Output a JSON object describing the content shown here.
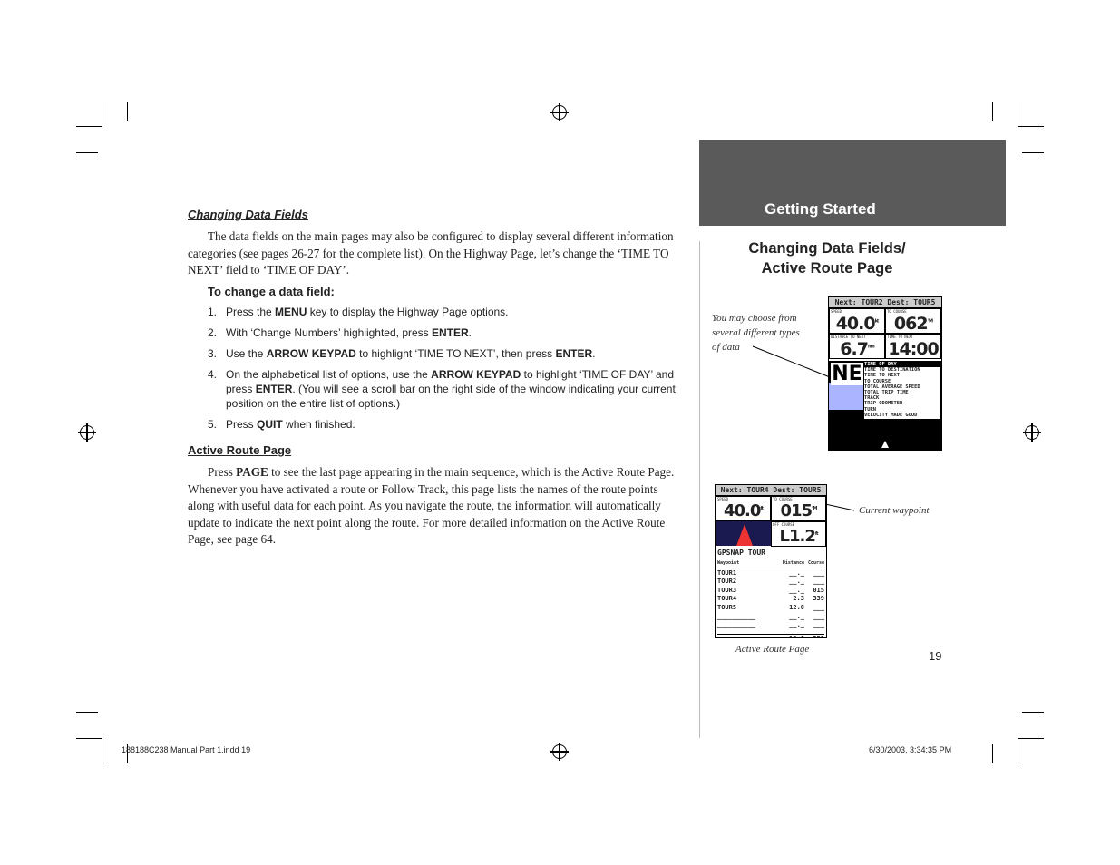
{
  "left": {
    "heading1": "Changing Data Fields",
    "para1": "The data fields on the main pages may also be configured to display several different information categories (see pages 26-27 for the complete list). On the Highway Page, let’s change the ‘TIME TO NEXT’ field to ‘TIME OF DAY’.",
    "subhead": "To change a data field:",
    "steps": [
      {
        "num": "1.",
        "parts": [
          "Press the ",
          "MENU",
          " key to display the Highway Page options."
        ]
      },
      {
        "num": "2.",
        "parts": [
          "With ‘Change Numbers’ highlighted, press ",
          "ENTER",
          "."
        ]
      },
      {
        "num": "3.",
        "parts": [
          "Use the ",
          "ARROW KEYPAD",
          " to highlight ‘TIME TO NEXT’, then press ",
          "ENTER",
          "."
        ]
      },
      {
        "num": "4.",
        "parts": [
          "On the alphabetical list of options, use the ",
          "ARROW KEYPAD",
          " to highlight ‘TIME OF DAY’ and press ",
          "ENTER",
          ". (You will see a scroll bar on the right side of the window indicating your current position on the entire list of options.)"
        ]
      },
      {
        "num": "5.",
        "parts": [
          "Press ",
          "QUIT",
          " when finished."
        ]
      }
    ],
    "heading2": "Active Route Page",
    "para2_pre": "Press ",
    "para2_key": "PAGE",
    "para2_post": " to see the last page appearing in the main sequence, which is the Active Route Page. Whenever you have activated a route or Follow Track, this page lists the names of the route points along with useful data for each point. As you navigate the route, the information will automatically update to indicate the next point along the route. For more detailed information on the Active Route Page, see page 64."
  },
  "right": {
    "tab_label": "Getting Started",
    "tab_color": "#5a5a5a",
    "title_line1": "Changing Data Fields/",
    "title_line2": "Active Route Page",
    "caption1": "You may choose from several different types of data",
    "caption2": "Current waypoint",
    "caption3": "Active Route Page",
    "page_number": "19"
  },
  "screen1": {
    "header": "Next: TOUR2   Dest: TOUR5",
    "fields": [
      {
        "label": "SPEED",
        "value": "40.0",
        "unit": "kt"
      },
      {
        "label": "TO COURSE",
        "value": "062",
        "unit": "°M"
      },
      {
        "label": "DISTANCE TO NEXT",
        "value": "6.7",
        "unit": "nm"
      },
      {
        "label": "TIME TO NEXT",
        "value": "14:00",
        "unit": ""
      }
    ],
    "compass": "NE",
    "options": [
      "TIME OF DAY",
      "TIME TO DESTINATION",
      "TIME TO NEXT",
      "TO COURSE",
      "TOTAL AVERAGE SPEED",
      "TOTAL TRIP TIME",
      "TRACK",
      "TRIP ODOMETER",
      "TURN",
      "VELOCITY MADE GOOD"
    ],
    "selected": "TIME OF DAY"
  },
  "screen2": {
    "header": "Next: TOUR4   Dest: TOUR5",
    "fields": [
      {
        "label": "SPEED",
        "value": "40.0",
        "unit": "ft"
      },
      {
        "label": "TO COURSE",
        "value": "015",
        "unit": "°M"
      },
      {
        "label": "OFF COURSE",
        "value": "L1.2",
        "unit": "ft"
      }
    ],
    "route_name": "GPSNAP TOUR",
    "columns": [
      "Waypoint",
      "Distance",
      "Course"
    ],
    "rows": [
      [
        "TOUR1",
        "__._",
        "___"
      ],
      [
        "TOUR2",
        "__._",
        "___"
      ],
      [
        "TOUR3",
        "__._",
        "015"
      ],
      [
        "TOUR4",
        "2.3",
        "339"
      ],
      [
        "TOUR5",
        "12.0",
        "___"
      ],
      [
        "__________",
        "__._",
        "___"
      ],
      [
        "__________",
        "__._",
        "___"
      ]
    ],
    "total": [
      "",
      "12.0",
      "351"
    ]
  },
  "footer": {
    "file": "188188C238 Manual Part 1.indd   19",
    "date": "6/30/2003, 3:34:35 PM"
  }
}
